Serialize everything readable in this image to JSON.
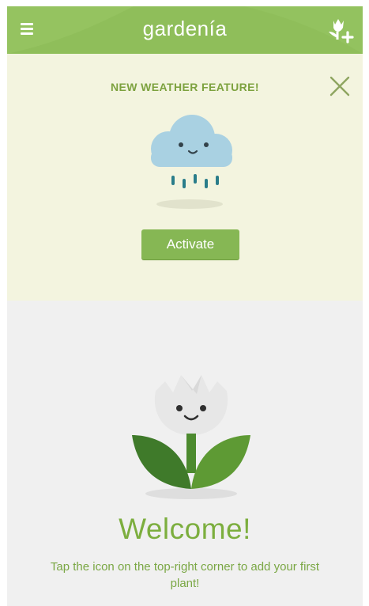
{
  "header": {
    "title": "gardenía",
    "menu_icon": "hamburger-menu-icon",
    "add_icon": "add-plant-icon"
  },
  "banner": {
    "title": "NEW WEATHER FEATURE!",
    "close_icon": "close-icon",
    "illustration": "rain-cloud-icon",
    "activate_label": "Activate"
  },
  "welcome": {
    "title": "Welcome!",
    "message": "Tap the icon on the top-right corner to add your first plant!",
    "illustration": "tulip-icon"
  },
  "colors": {
    "header": "#8fbe5a",
    "banner_bg": "#f3f4df",
    "accent": "#86b754",
    "welcome_bg": "#f0f0f0",
    "leaf_dark": "#3f7a2a",
    "leaf_light": "#5e9a34",
    "cloud": "#a9d1e2",
    "rain": "#2a7d8a"
  }
}
